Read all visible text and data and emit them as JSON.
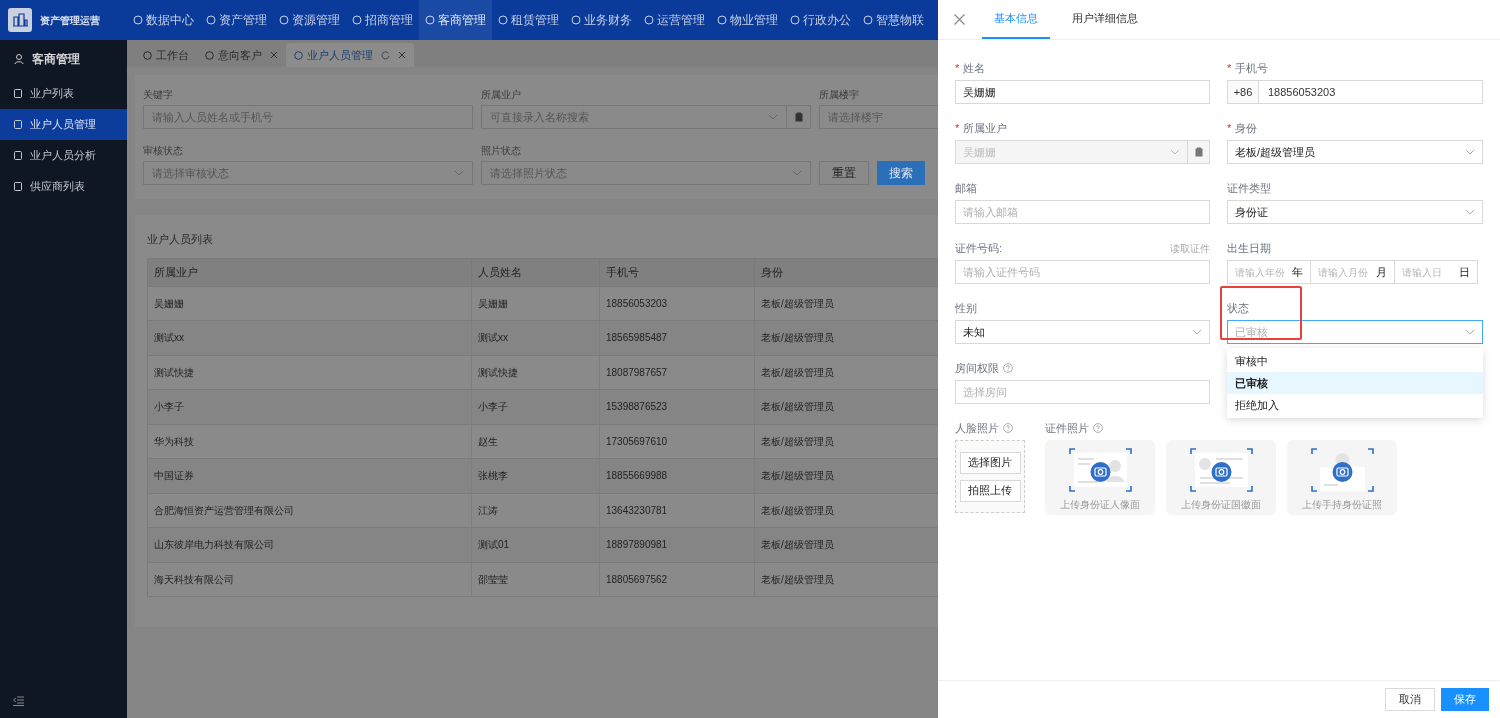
{
  "app": {
    "title": "资产管理运营"
  },
  "nav": [
    {
      "label": "数据中心",
      "selected": false
    },
    {
      "label": "资产管理",
      "selected": false
    },
    {
      "label": "资源管理",
      "selected": false
    },
    {
      "label": "招商管理",
      "selected": false
    },
    {
      "label": "客商管理",
      "selected": true
    },
    {
      "label": "租赁管理",
      "selected": false
    },
    {
      "label": "业务财务",
      "selected": false
    },
    {
      "label": "运营管理",
      "selected": false
    },
    {
      "label": "物业管理",
      "selected": false
    },
    {
      "label": "行政办公",
      "selected": false
    },
    {
      "label": "智慧物联",
      "selected": false
    }
  ],
  "sidebar": {
    "heading": "客商管理",
    "items": [
      {
        "label": "业户列表",
        "selected": false
      },
      {
        "label": "业户人员管理",
        "selected": true
      },
      {
        "label": "业户人员分析",
        "selected": false
      },
      {
        "label": "供应商列表",
        "selected": false
      }
    ]
  },
  "page_tabs": [
    {
      "label": "工作台",
      "selected": false,
      "closable": false
    },
    {
      "label": "意向客户",
      "selected": false,
      "closable": true
    },
    {
      "label": "业户人员管理",
      "selected": true,
      "closable": true
    }
  ],
  "filters": [
    {
      "label": "关键字",
      "placeholder": "请输入人员姓名或手机号",
      "kind": "text"
    },
    {
      "label": "所属业户",
      "placeholder": "可直接录入名称搜索",
      "kind": "select_clip"
    },
    {
      "label": "所属楼宇",
      "placeholder": "请选择楼宇",
      "kind": "text"
    },
    {
      "label": "审核状态",
      "placeholder": "请选择审核状态",
      "kind": "select"
    },
    {
      "label": "照片状态",
      "placeholder": "请选择照片状态",
      "kind": "select"
    }
  ],
  "filter_buttons": [
    "重置",
    "搜索"
  ],
  "table": {
    "title": "业户人员列表",
    "columns": [
      "所属业户",
      "人员姓名",
      "手机号",
      "身份"
    ],
    "rows": [
      [
        "吴姗姗",
        "吴姗姗",
        "18856053203",
        "老板/超级管理员"
      ],
      [
        "测试xx",
        "测试xx",
        "18565985487",
        "老板/超级管理员"
      ],
      [
        "测试快捷",
        "测试快捷",
        "18087987657",
        "老板/超级管理员"
      ],
      [
        "小李子",
        "小李子",
        "15398876523",
        "老板/超级管理员"
      ],
      [
        "华为科技",
        "赵生",
        "17305697610",
        "老板/超级管理员"
      ],
      [
        "中国证券",
        "张桃李",
        "18855669988",
        "老板/超级管理员"
      ],
      [
        "合肥海恒资产运营管理有限公司",
        "江涛",
        "13643230781",
        "老板/超级管理员"
      ],
      [
        "山东彼岸电力科技有限公司",
        "测试01",
        "18897890981",
        "老板/超级管理员"
      ],
      [
        "海天科技有限公司",
        "邵莹莹",
        "18805697562",
        "老板/超级管理员"
      ]
    ]
  },
  "drawer": {
    "required_mark": "*",
    "tabs": [
      {
        "label": "基本信息",
        "selected": true
      },
      {
        "label": "用户详细信息",
        "selected": false
      }
    ],
    "fields": [
      {
        "label": "姓名",
        "required": true,
        "help": false,
        "kind": "text",
        "value": "吴姗姗"
      },
      {
        "label": "手机号",
        "required": true,
        "help": false,
        "kind": "phone",
        "prefix": "+86",
        "value": "18856053203"
      },
      {
        "label": "所属业户",
        "required": true,
        "help": false,
        "kind": "locked_select",
        "value": "吴姗姗"
      },
      {
        "label": "身份",
        "required": true,
        "help": false,
        "kind": "select",
        "value": "老板/超级管理员"
      },
      {
        "label": "邮箱",
        "required": false,
        "help": false,
        "kind": "text",
        "placeholder": "请输入邮箱"
      },
      {
        "label": "证件类型",
        "required": false,
        "help": false,
        "kind": "select",
        "value": "身份证"
      },
      {
        "label": "证件号码:",
        "required": false,
        "help": false,
        "kind": "text",
        "placeholder": "请输入证件号码",
        "action": "读取证件"
      },
      {
        "label": "出生日期",
        "required": false,
        "help": false,
        "kind": "date",
        "parts": [
          {
            "placeholder": "请输入年份",
            "unit": "年"
          },
          {
            "placeholder": "请输入月份",
            "unit": "月"
          },
          {
            "placeholder": "请输入日",
            "unit": "日"
          }
        ]
      },
      {
        "label": "性别",
        "required": false,
        "help": false,
        "kind": "select",
        "value": "未知"
      },
      {
        "label": "状态",
        "required": false,
        "help": false,
        "kind": "select",
        "placeholder": "已审核",
        "expanded": true,
        "highlighted": true,
        "options": [
          {
            "label": "审核中",
            "selected": false
          },
          {
            "label": "已审核",
            "selected": true
          },
          {
            "label": "拒绝加入",
            "selected": false
          }
        ]
      },
      {
        "label": "房间权限",
        "required": false,
        "help": true,
        "kind": "text",
        "placeholder": "选择房间"
      }
    ],
    "face_photo": {
      "label": "人脸照片",
      "help": true,
      "buttons": [
        "选择图片",
        "拍照上传"
      ]
    },
    "id_photos": {
      "label": "证件照片",
      "help": true,
      "cards": [
        {
          "caption": "上传身份证人像面",
          "kind": "portrait"
        },
        {
          "caption": "上传身份证国徽面",
          "kind": "emblem"
        },
        {
          "caption": "上传手持身份证照",
          "kind": "handheld"
        }
      ]
    },
    "footer_buttons": [
      {
        "label": "取消",
        "kind": "secondary"
      },
      {
        "label": "保存",
        "kind": "primary"
      }
    ]
  }
}
